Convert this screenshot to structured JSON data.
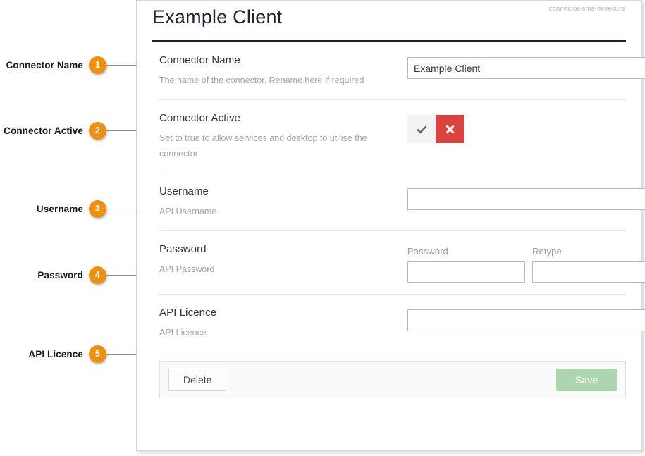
{
  "panel": {
    "title": "Example Client",
    "tag": "connector-sms-misecure"
  },
  "rows": [
    {
      "title": "Connector Name",
      "description": "The name of the connector. Rename here if required",
      "value": "Example Client",
      "placeholder": ""
    },
    {
      "title": "Connector Active",
      "description": "Set to true to allow services and desktop to utilise the connector",
      "toggle": {
        "yes_icon": "check-icon",
        "no_icon": "cross-icon",
        "selected": "no",
        "yes_color": "#f3f3f3",
        "no_color": "#d9453e"
      }
    },
    {
      "title": "Username",
      "description": "API Username",
      "value": "",
      "placeholder": ""
    },
    {
      "title": "Password",
      "description": "API Password",
      "password_label": "Password",
      "retype_label": "Retype",
      "password_value": "",
      "retype_value": ""
    },
    {
      "title": "API Licence",
      "description": "API Licence",
      "value": "",
      "placeholder": ""
    }
  ],
  "footer": {
    "delete_label": "Delete",
    "save_label": "Save",
    "save_color": "#aed6ae"
  },
  "annotations": [
    {
      "number": "1",
      "label": "Connector Name"
    },
    {
      "number": "2",
      "label": "Connector Active"
    },
    {
      "number": "3",
      "label": "Username"
    },
    {
      "number": "4",
      "label": "Password"
    },
    {
      "number": "5",
      "label": "API Licence"
    }
  ],
  "colors": {
    "badge": "#ec9013",
    "header_rule": "#192431",
    "danger": "#d9453e"
  }
}
